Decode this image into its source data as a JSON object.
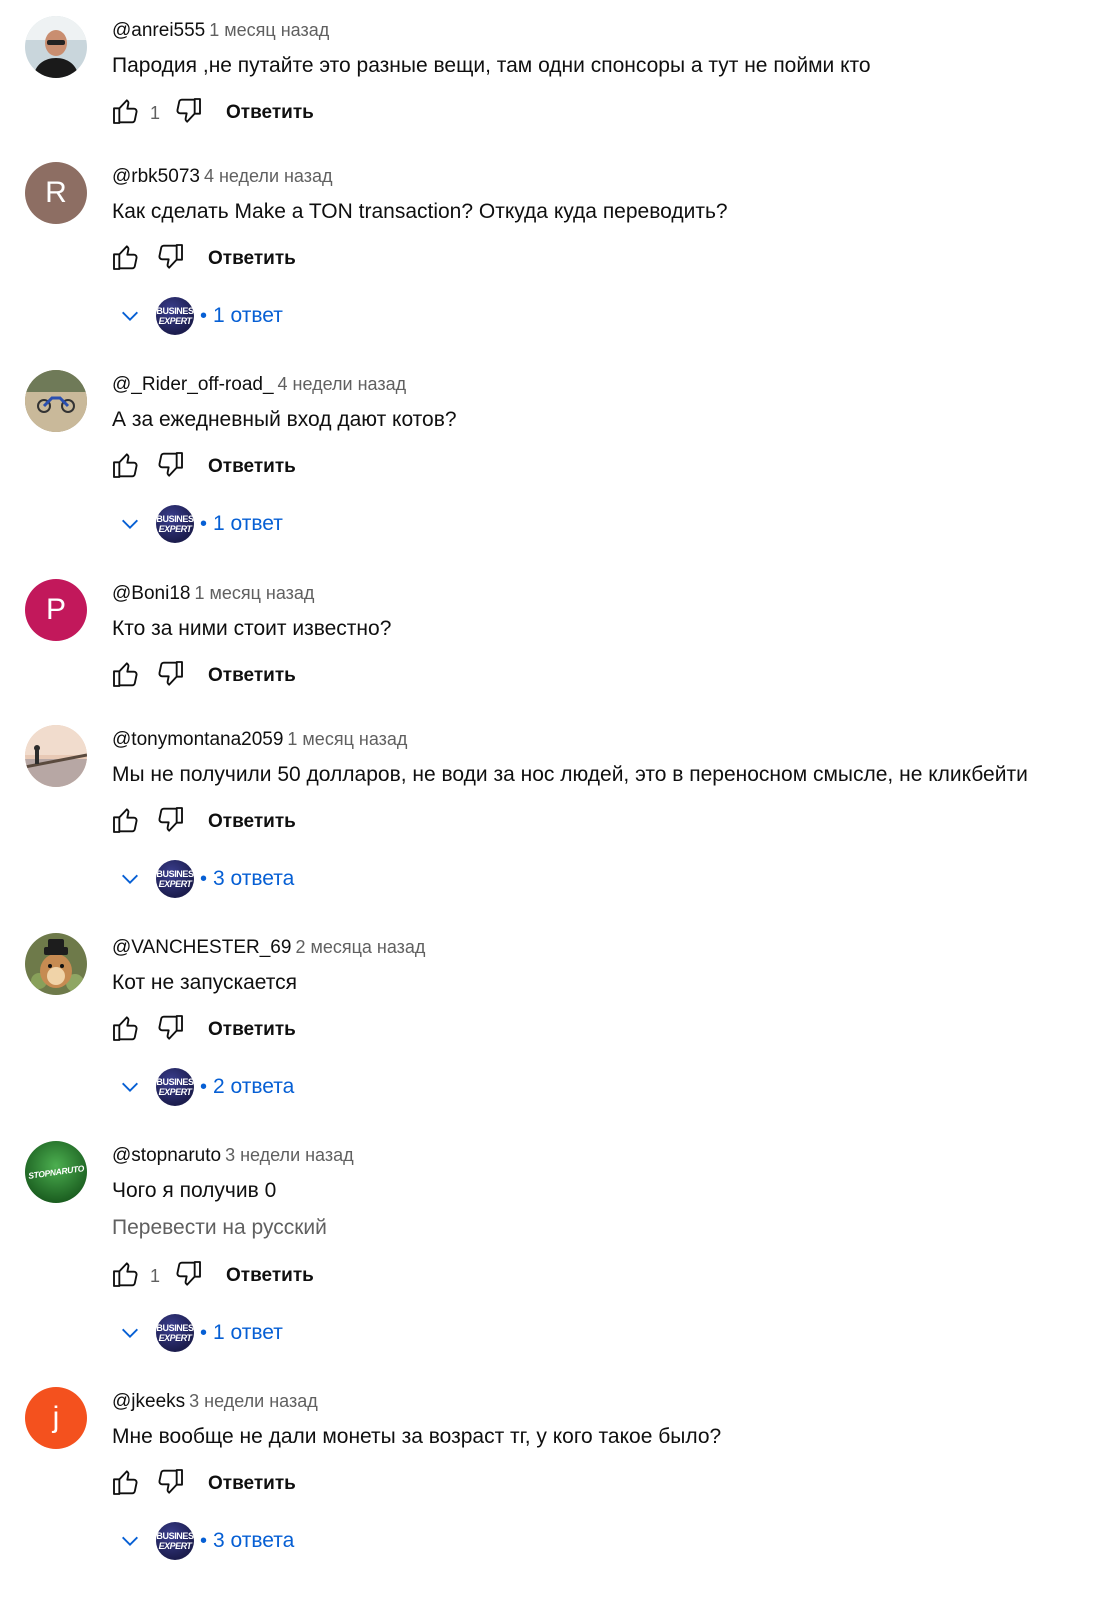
{
  "comments": [
    {
      "author": "@anrei555",
      "time": "1 месяц назад",
      "text": "Пародия ,не путайте это разные вещи, там одни спонсоры а тут не пойми кто",
      "likes": "1",
      "reply_label": "Ответить",
      "avatar": "photo-man"
    },
    {
      "author": "@rbk5073",
      "time": "4 недели назад",
      "text": "Как сделать Make a TON transaction? Откуда куда переводить?",
      "likes": "",
      "reply_label": "Ответить",
      "avatar": "letter",
      "avatar_letter": "R",
      "avatar_color": "#8d6e63",
      "replies": "1 ответ"
    },
    {
      "author": "@_Rider_off-road_",
      "time": "4 недели назад",
      "text": "А за ежедневный вход дают котов?",
      "likes": "",
      "reply_label": "Ответить",
      "avatar": "photo-moto",
      "replies": "1 ответ"
    },
    {
      "author": "@Boni18",
      "time": "1 месяц назад",
      "text": "Кто за ними стоит известно?",
      "likes": "",
      "reply_label": "Ответить",
      "avatar": "letter",
      "avatar_letter": "P",
      "avatar_color": "#c2185b"
    },
    {
      "author": "@tonymontana2059",
      "time": "1 месяц назад",
      "text": "Мы не получили 50 долларов, не води за нос людей, это в переносном смысле, не кликбейти",
      "likes": "",
      "reply_label": "Ответить",
      "avatar": "photo-pier",
      "replies": "3 ответа"
    },
    {
      "author": "@VANCHESTER_69",
      "time": "2 месяца назад",
      "text": "Кот не запускается",
      "likes": "",
      "reply_label": "Ответить",
      "avatar": "photo-hamster",
      "replies": "2 ответа"
    },
    {
      "author": "@stopnaruto",
      "time": "3 недели назад",
      "text": "Чого я получив 0",
      "translate": "Перевести на русский",
      "likes": "1",
      "reply_label": "Ответить",
      "avatar": "stopnaruto",
      "avatar_text": "STOPNARUTO",
      "replies": "1 ответ"
    },
    {
      "author": "@jkeeks",
      "time": "3 недели назад",
      "text": "Мне вообще не дали монеты за возраст тг, у кого такое было?",
      "likes": "",
      "reply_label": "Ответить",
      "avatar": "letter",
      "avatar_letter": "j",
      "avatar_color": "#f4511e",
      "replies": "3 ответа"
    }
  ],
  "channel_avatar": {
    "line1": "BUSINES",
    "line2": "EXPERT"
  },
  "reply_separator": "•",
  "colors": {
    "author": "#0f0f0f",
    "meta": "#606060",
    "link": "#065fd4",
    "background": "#ffffff"
  }
}
